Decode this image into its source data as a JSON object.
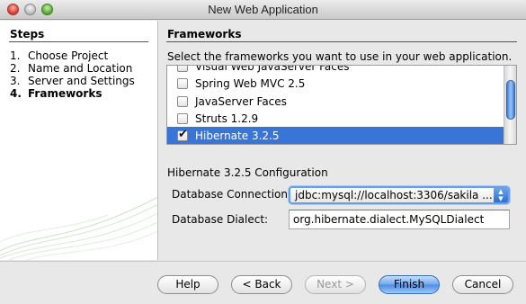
{
  "window": {
    "title": "New Web Application"
  },
  "steps": {
    "heading": "Steps",
    "items": [
      {
        "num": "1.",
        "label": "Choose Project"
      },
      {
        "num": "2.",
        "label": "Name and Location"
      },
      {
        "num": "3.",
        "label": "Server and Settings"
      },
      {
        "num": "4.",
        "label": "Frameworks",
        "current": true
      }
    ]
  },
  "frameworks": {
    "heading": "Frameworks",
    "description": "Select the frameworks you want to use in your web application.",
    "items": [
      {
        "label": "Visual Web JavaServer Faces",
        "checked": false
      },
      {
        "label": "Spring Web MVC 2.5",
        "checked": false
      },
      {
        "label": "JavaServer Faces",
        "checked": false
      },
      {
        "label": "Struts 1.2.9",
        "checked": false
      },
      {
        "label": "Hibernate 3.2.5",
        "checked": true,
        "selected": true
      }
    ]
  },
  "config": {
    "heading": "Hibernate 3.2.5 Configuration",
    "connection_label": "Database Connection:",
    "connection_value": "jdbc:mysql://localhost:3306/sakila ...",
    "dialect_label": "Database Dialect:",
    "dialect_value": "org.hibernate.dialect.MySQLDialect"
  },
  "buttons": {
    "help": "Help",
    "back": "< Back",
    "next": "Next >",
    "finish": "Finish",
    "cancel": "Cancel"
  },
  "colors": {
    "selection": "#3875d7",
    "default_button": "#4a8de4"
  }
}
